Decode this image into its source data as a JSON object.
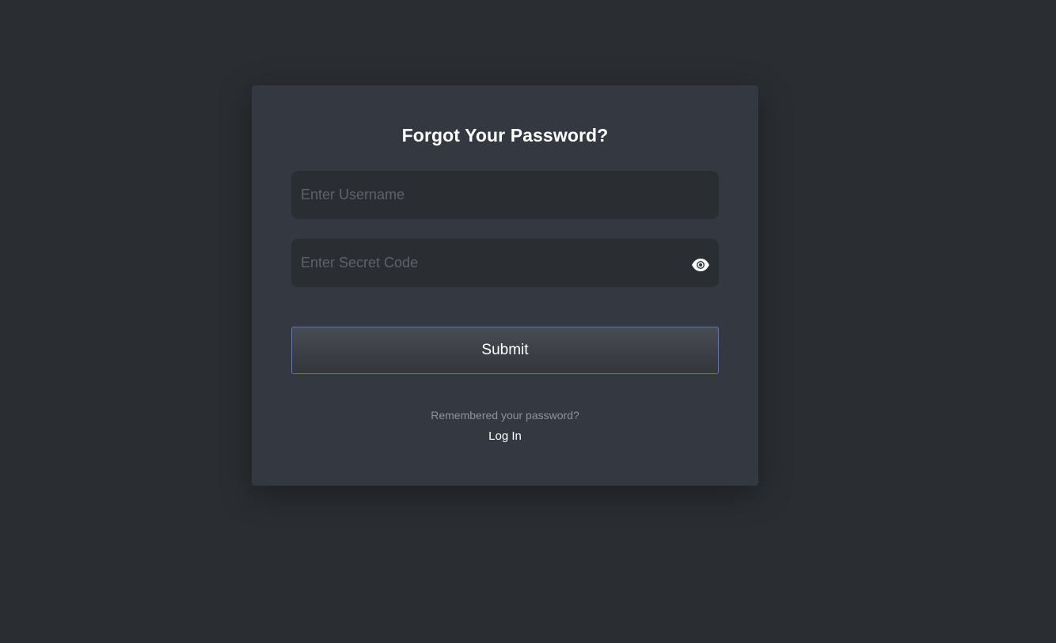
{
  "form": {
    "title": "Forgot Your Password?",
    "username": {
      "placeholder": "Enter Username",
      "value": ""
    },
    "secret_code": {
      "placeholder": "Enter Secret Code",
      "value": "",
      "toggle_icon": "eye-icon"
    },
    "submit_label": "Submit",
    "footer_prompt": "Remembered your password?",
    "login_link": "Log In"
  },
  "colors": {
    "background": "#2a2d32",
    "card": "#343941",
    "input": "#2a2d32",
    "accent_border": "#5a6fd6",
    "text": "#ffffff",
    "muted_text": "#8e9399"
  }
}
